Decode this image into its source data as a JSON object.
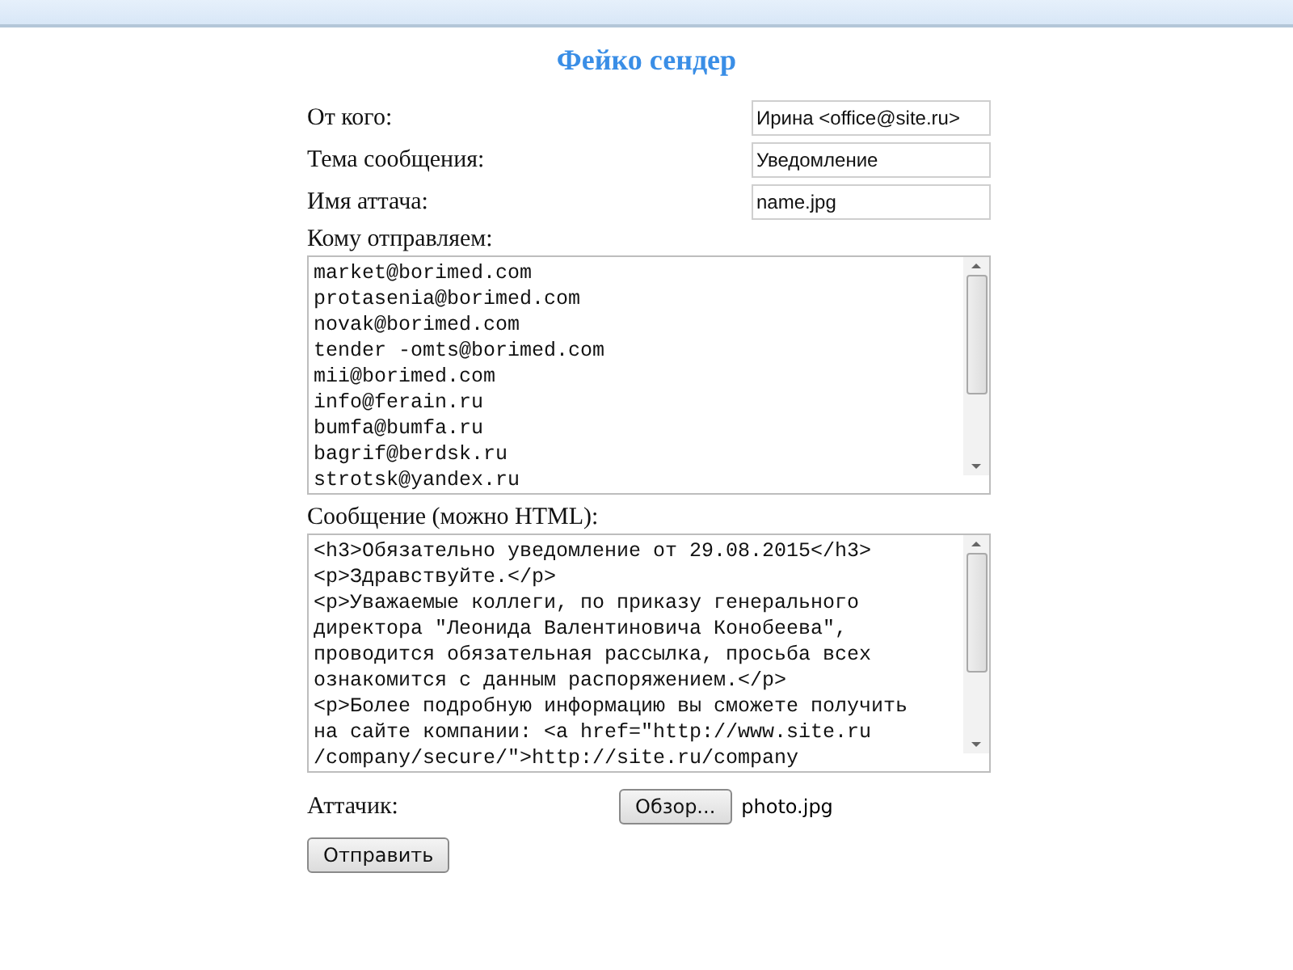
{
  "title": "Фейко сендер",
  "fields": [
    {
      "label": "От кого:",
      "value": "Ирина <office@site.ru>"
    },
    {
      "label": "Тема сообщения:",
      "value": "Уведомление"
    },
    {
      "label": "Имя аттача:",
      "value": "name.jpg"
    }
  ],
  "recipients": {
    "label": "Кому отправляем:",
    "lines": [
      "market@borimed.com",
      "protasenia@borimed.com",
      "novak@borimed.com",
      "tender -omts@borimed.com",
      "mii@borimed.com",
      "info@ferain.ru",
      "bumfa@bumfa.ru",
      "bagrif@berdsk.ru",
      "strotsk@yandex.ru"
    ]
  },
  "message": {
    "label": "Сообщение (можно HTML):",
    "lines": [
      "<h3>Обязательно уведомление от 29.08.2015</h3>",
      "<p>Здравствуйте.</p>",
      "<p>Уважаемые коллеги, по приказу генерального",
      "директора \"Леонида Валентиновича Конобеева\",",
      "проводится обязательная рассылка, просьба всех",
      "ознакомится с данным распоряжением.</p>",
      "<p>Более подробную информацию вы сможете получить",
      "на сайте компании: <a href=\"http://www.site.ru",
      "/company/secure/\">http://site.ru/company"
    ]
  },
  "attachment": {
    "label": "Аттачик:",
    "button": "Обзор...",
    "file": "photo.jpg"
  },
  "submit": "Отправить"
}
